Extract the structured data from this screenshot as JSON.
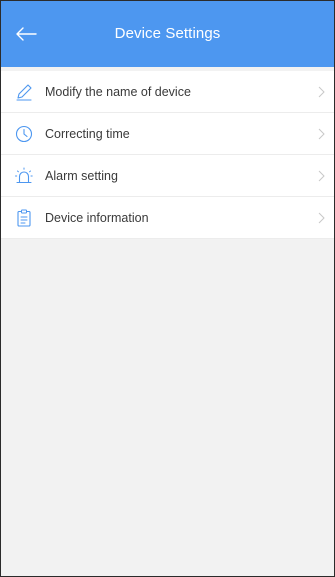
{
  "header": {
    "title": "Device Settings",
    "back_icon": "back-arrow-icon",
    "background_color": "#4d97f0"
  },
  "menu": {
    "items": [
      {
        "label": "Modify the name of device",
        "icon": "pencil-icon"
      },
      {
        "label": "Correcting time",
        "icon": "clock-icon"
      },
      {
        "label": "Alarm setting",
        "icon": "alarm-icon"
      },
      {
        "label": "Device information",
        "icon": "clipboard-icon"
      }
    ],
    "chevron_icon": "chevron-right-icon",
    "icon_color": "#4d97f0"
  }
}
